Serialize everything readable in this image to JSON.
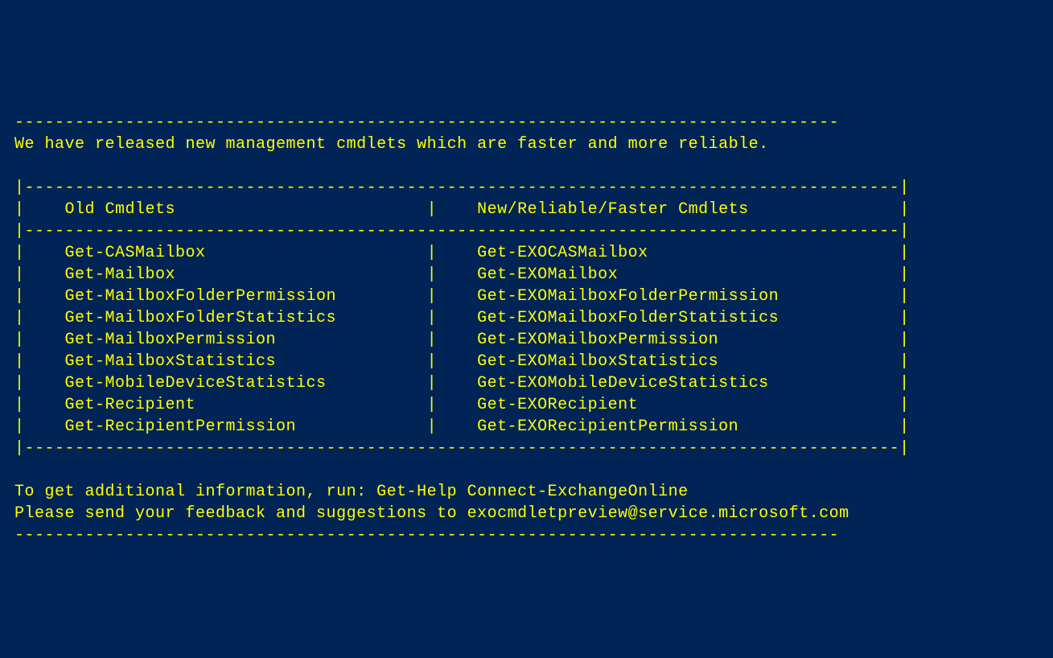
{
  "divider_top": "----------------------------------------------------------------------------------",
  "intro_message": "We have released new management cmdlets which are faster and more reliable.",
  "table": {
    "border_top": "|---------------------------------------------------------------------------------------|",
    "header_left": "Old Cmdlets",
    "header_right": "New/Reliable/Faster Cmdlets",
    "border_mid": "|---------------------------------------------------------------------------------------|",
    "rows": [
      {
        "old": "Get-CASMailbox",
        "new": "Get-EXOCASMailbox"
      },
      {
        "old": "Get-Mailbox",
        "new": "Get-EXOMailbox"
      },
      {
        "old": "Get-MailboxFolderPermission",
        "new": "Get-EXOMailboxFolderPermission"
      },
      {
        "old": "Get-MailboxFolderStatistics",
        "new": "Get-EXOMailboxFolderStatistics"
      },
      {
        "old": "Get-MailboxPermission",
        "new": "Get-EXOMailboxPermission"
      },
      {
        "old": "Get-MailboxStatistics",
        "new": "Get-EXOMailboxStatistics"
      },
      {
        "old": "Get-MobileDeviceStatistics",
        "new": "Get-EXOMobileDeviceStatistics"
      },
      {
        "old": "Get-Recipient",
        "new": "Get-EXORecipient"
      },
      {
        "old": "Get-RecipientPermission",
        "new": "Get-EXORecipientPermission"
      }
    ],
    "border_bottom": "|---------------------------------------------------------------------------------------|"
  },
  "help_message": "To get additional information, run: Get-Help Connect-ExchangeOnline",
  "feedback_message": "Please send your feedback and suggestions to exocmdletpreview@service.microsoft.com",
  "divider_bottom": "----------------------------------------------------------------------------------"
}
